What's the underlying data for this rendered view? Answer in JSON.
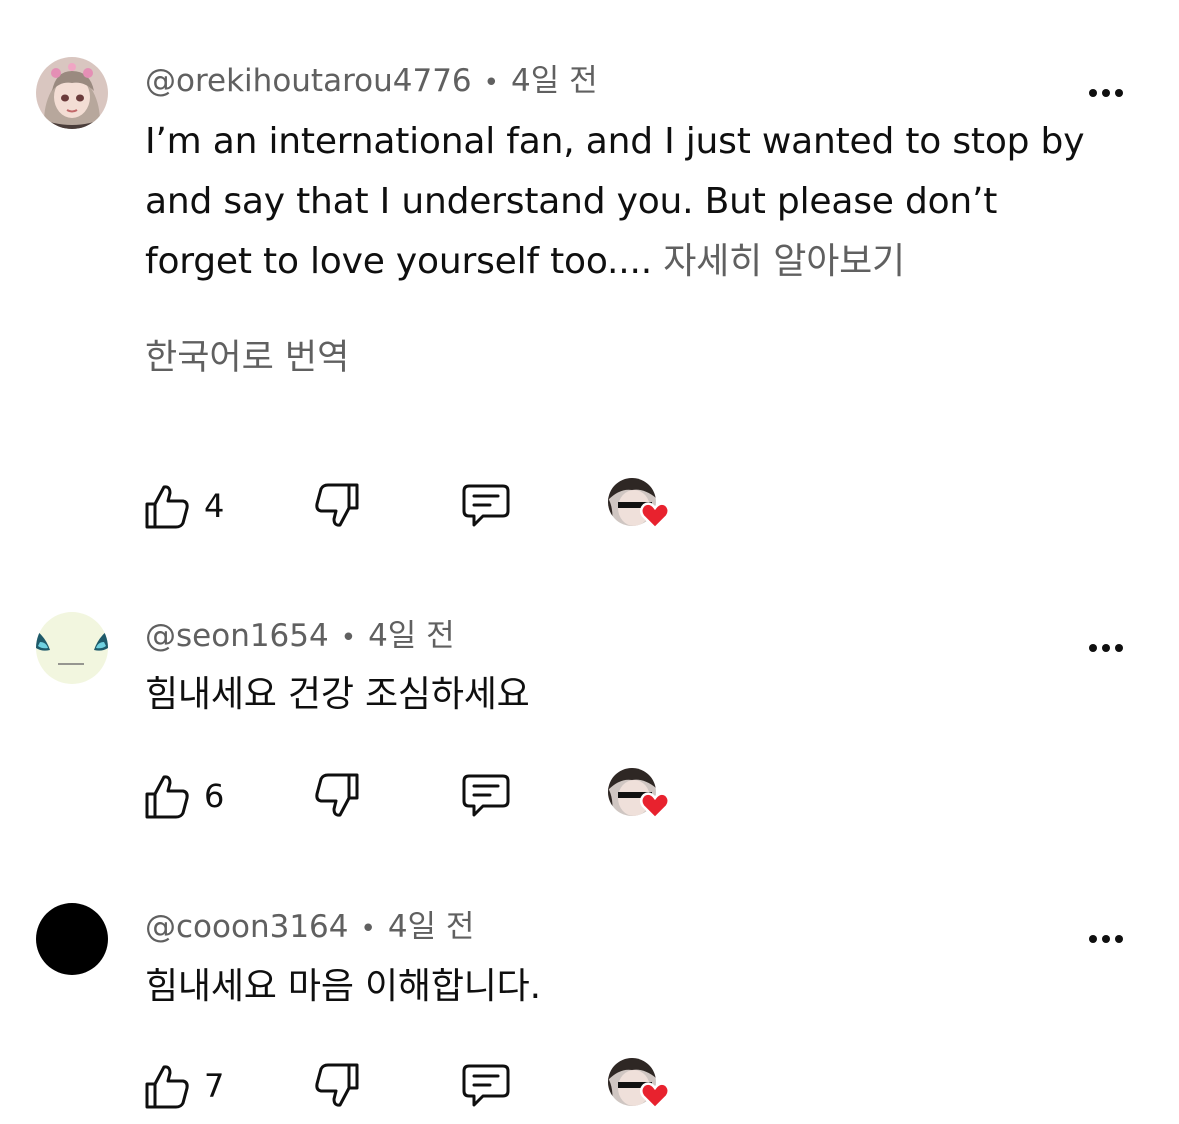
{
  "comments": [
    {
      "author": "@orekihoutarou4776",
      "separator": "•",
      "time": "4일 전",
      "text": "I’m an international fan, and I just wanted to stop by and say that I understand you. But please don’t forget to love yourself too....",
      "more_label": "자세히 알아보기",
      "translate_label": "한국어로 번역",
      "like_count": "4",
      "avatar_icon": "anime-girl-avatar"
    },
    {
      "author": "@seon1654",
      "separator": "•",
      "time": "4일 전",
      "text": "힘내세요 건강 조심하세요",
      "like_count": "6",
      "avatar_icon": "cartoon-face-avatar"
    },
    {
      "author": "@cooon3164",
      "separator": "•",
      "time": "4일 전",
      "text": "힘내세요 마음 이해합니다.",
      "like_count": "7",
      "avatar_icon": "black-circle-avatar"
    }
  ],
  "colors": {
    "text_primary": "#0f0f0f",
    "text_secondary": "#606060",
    "heart": "#e8222e"
  }
}
